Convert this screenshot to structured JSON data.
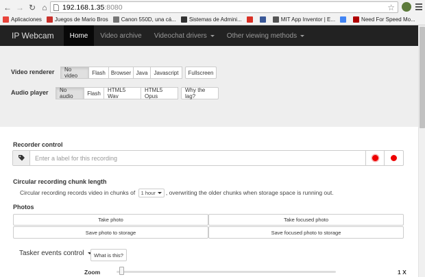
{
  "browser": {
    "url_host": "192.168.1.35",
    "url_port": ":8080",
    "bookmarks": [
      {
        "label": "Aplicaciones",
        "color": "#e8453c"
      },
      {
        "label": "Juegos de Mario Bros",
        "color": "#c8312b"
      },
      {
        "label": "Canon 550D, una cá...",
        "color": "#777777"
      },
      {
        "label": "Sistemas de Admini...",
        "color": "#333333"
      },
      {
        "label": "",
        "color": "#d93025"
      },
      {
        "label": "",
        "color": "#3b5998"
      },
      {
        "label": "MIT App Inventor | E...",
        "color": "#555555"
      },
      {
        "label": "",
        "color": "#4285f4"
      },
      {
        "label": "Need For Speed Mo...",
        "color": "#b00000"
      }
    ]
  },
  "navbar": {
    "brand": "IP Webcam",
    "items": [
      {
        "label": "Home",
        "active": true,
        "dropdown": false
      },
      {
        "label": "Video archive",
        "active": false,
        "dropdown": false
      },
      {
        "label": "Videochat drivers",
        "active": false,
        "dropdown": true
      },
      {
        "label": "Other viewing methods",
        "active": false,
        "dropdown": true
      }
    ]
  },
  "video_renderer": {
    "label": "Video renderer",
    "options": [
      "No video",
      "Flash",
      "Browser",
      "Java",
      "Javascript"
    ],
    "selected": "No video",
    "extra": "Fullscreen"
  },
  "audio_player": {
    "label": "Audio player",
    "options": [
      "No audio",
      "Flash",
      "HTML5 Wav",
      "HTML5 Opus"
    ],
    "selected": "No audio",
    "extra": "Why the lag?"
  },
  "recorder": {
    "title": "Recorder control",
    "placeholder": "Enter a label for this recording"
  },
  "chunk": {
    "title": "Circular recording chunk length",
    "text_before": "Circular recording records video in chunks of",
    "value": "1 hour",
    "text_after": ", overwriting the older chunks when storage space is running out."
  },
  "photos": {
    "title": "Photos",
    "take_photo": "Take photo",
    "take_focused": "Take focused photo",
    "save_photo": "Save photo to storage",
    "save_focused": "Save focused photo to storage"
  },
  "tasker": {
    "label": "Tasker events control",
    "help": "What is this?"
  },
  "zoom": {
    "label": "Zoom",
    "value": "1 X",
    "level": 0.0
  },
  "colors": {
    "navbar_bg": "#222222",
    "record_red": "#ee0000"
  }
}
